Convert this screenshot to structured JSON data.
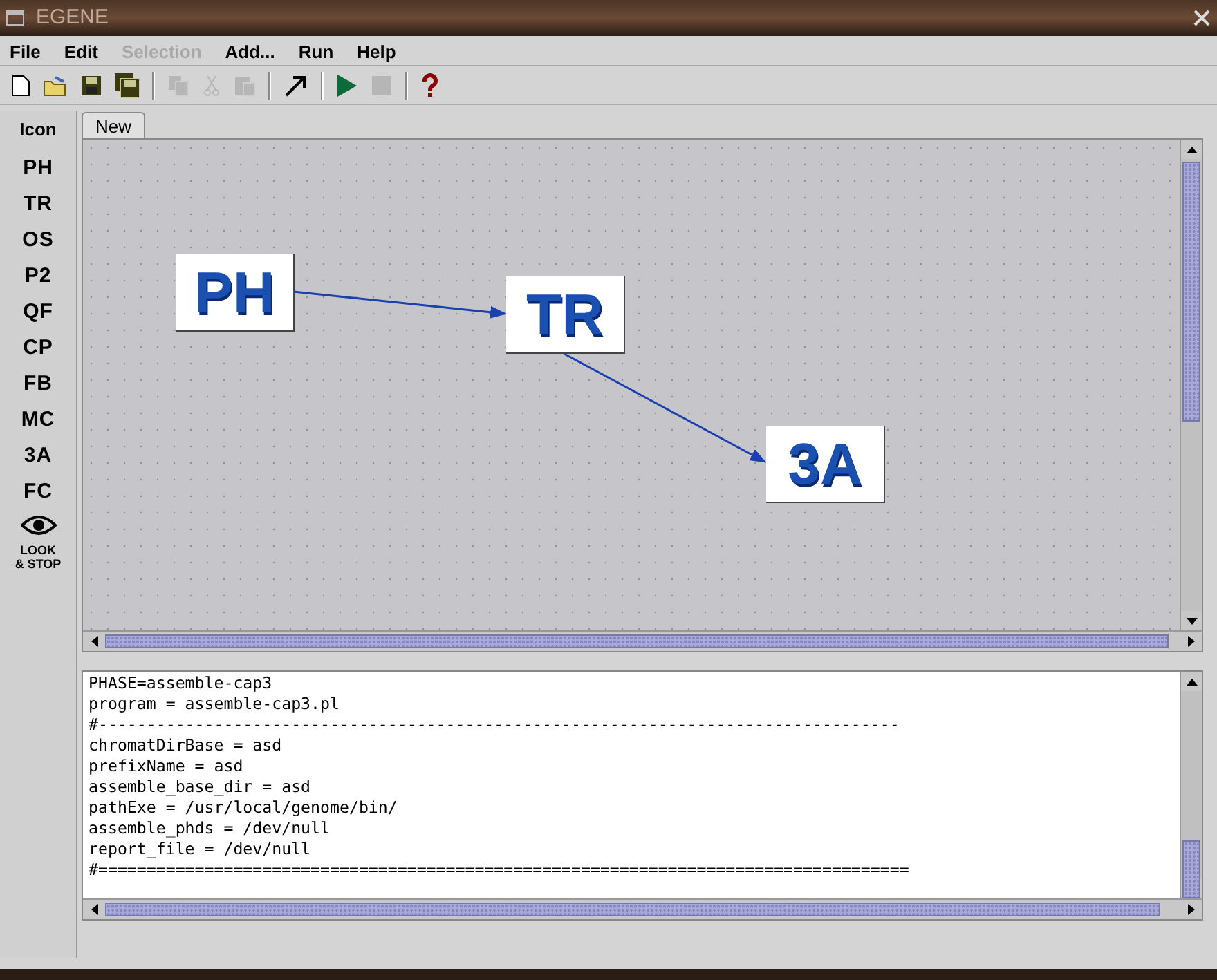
{
  "window": {
    "title": "EGENE"
  },
  "menu": [
    {
      "label": "File",
      "disabled": false
    },
    {
      "label": "Edit",
      "disabled": false
    },
    {
      "label": "Selection",
      "disabled": true
    },
    {
      "label": "Add...",
      "disabled": false
    },
    {
      "label": "Run",
      "disabled": false
    },
    {
      "label": "Help",
      "disabled": false
    }
  ],
  "toolbar": [
    {
      "kind": "new",
      "disabled": false
    },
    {
      "kind": "open",
      "disabled": false
    },
    {
      "kind": "save",
      "disabled": false
    },
    {
      "kind": "saveall",
      "disabled": false
    },
    {
      "kind": "sep"
    },
    {
      "kind": "copy",
      "disabled": true
    },
    {
      "kind": "cut",
      "disabled": true
    },
    {
      "kind": "paste",
      "disabled": true
    },
    {
      "kind": "sep"
    },
    {
      "kind": "arrow",
      "disabled": false
    },
    {
      "kind": "sep"
    },
    {
      "kind": "run",
      "disabled": false
    },
    {
      "kind": "stop",
      "disabled": true
    },
    {
      "kind": "sep"
    },
    {
      "kind": "help",
      "disabled": false
    }
  ],
  "palette": {
    "title": "Icon",
    "items": [
      {
        "kind": "text",
        "label": "PH"
      },
      {
        "kind": "text",
        "label": "TR"
      },
      {
        "kind": "text",
        "label": "OS"
      },
      {
        "kind": "text",
        "label": "P2"
      },
      {
        "kind": "text",
        "label": "QF"
      },
      {
        "kind": "text",
        "label": "CP"
      },
      {
        "kind": "text",
        "label": "FB"
      },
      {
        "kind": "text",
        "label": "MC"
      },
      {
        "kind": "text",
        "label": "3A"
      },
      {
        "kind": "text",
        "label": "FC"
      },
      {
        "kind": "eye",
        "label": "LOOK & STOP"
      }
    ]
  },
  "tabs": [
    {
      "label": "New",
      "selected": true
    }
  ],
  "canvas": {
    "nodes": [
      {
        "label": "PH"
      },
      {
        "label": "TR"
      },
      {
        "label": "3A"
      }
    ]
  },
  "text_area": {
    "lines": [
      "PHASE=assemble-cap3",
      "program = assemble-cap3.pl",
      "#-----------------------------------------------------------------------------------",
      "chromatDirBase = asd",
      "prefixName = asd",
      "assemble_base_dir = asd",
      "pathExe = /usr/local/genome/bin/",
      "assemble_phds = /dev/null",
      "report_file = /dev/null",
      "#===================================================================================="
    ]
  }
}
